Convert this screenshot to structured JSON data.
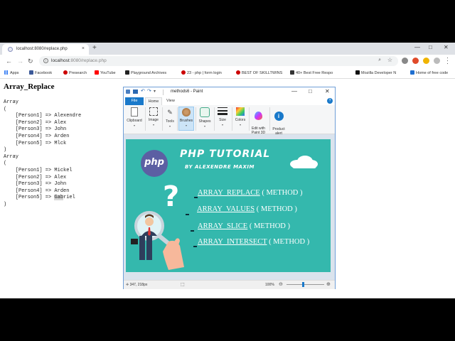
{
  "browser": {
    "tab_title": "localhost:8080/replace.php",
    "tab_close": "×",
    "new_tab": "+",
    "url_host": "localhost",
    "url_rest": ":8080/replace.php",
    "win_minimize": "—",
    "win_maximize": "□",
    "win_close": "✕",
    "bookmarks": [
      {
        "label": "Apps",
        "color": "#4285f4"
      },
      {
        "label": "Facebook",
        "color": "#3b5998"
      },
      {
        "label": "Presearch",
        "color": "#c00"
      },
      {
        "label": "YouTube",
        "color": "#ff0000"
      },
      {
        "label": "Playground Archives",
        "color": "#222"
      },
      {
        "label": "23 - php | form login",
        "color": "#c00"
      },
      {
        "label": "BEST OF SKILLTWINS",
        "color": "#c00"
      },
      {
        "label": "40+ Best Free Respo",
        "color": "#333"
      },
      {
        "label": "Mozilla Developer N",
        "color": "#111"
      },
      {
        "label": "Home of free code",
        "color": "#1f6fd0"
      }
    ]
  },
  "page": {
    "heading": "Array_Replace",
    "array1": {
      "label": "Array",
      "open": "(",
      "close": ")",
      "lines": [
        "    [Person1] => Alexendre",
        "    [Person2] => Alex",
        "    [Person3] => John",
        "    [Person4] => Arden",
        "    [Person5] => Mlck"
      ]
    },
    "array2": {
      "label": "Array",
      "open": "(",
      "close": ")",
      "lines": [
        "    [Person1] => Mickel",
        "    [Person2] => Alex",
        "    [Person3] => John",
        "    [Person4] => Arden"
      ],
      "last_prefix": "    [Person5] => ",
      "last_highlight": "Gab",
      "last_suffix": "riel"
    }
  },
  "paint": {
    "title": "methods6 - Paint",
    "tabs": {
      "file": "File",
      "home": "Home",
      "view": "View",
      "help": "?"
    },
    "groups": [
      {
        "label": "Clipboard"
      },
      {
        "label": "Image"
      },
      {
        "label": "Tools"
      },
      {
        "label": "Brushes"
      },
      {
        "label": "Shapes"
      },
      {
        "label": "Size"
      },
      {
        "label": "Colors"
      },
      {
        "label": "Edit with\nPaint 3D"
      },
      {
        "label": "Product\nalert"
      }
    ],
    "status_pos": "347, 218px",
    "zoom": "100%",
    "zoom_fraction": 0.45,
    "slide": {
      "logo": "php",
      "title": "PHP TUTORIAL",
      "subtitle": "BY ALEXENDRE MAXIM",
      "question": "?",
      "functions": [
        {
          "name": "ARRAY_REPLACE",
          "rest": " ( METHOD )"
        },
        {
          "name": "ARRAY_VALUES",
          "rest": " ( METHOD )"
        },
        {
          "name": "ARRAY_SLICE",
          "rest": " ( METHOD )"
        },
        {
          "name": "ARRAY_INTERSECT",
          "rest": " ( METHOD )"
        }
      ]
    }
  }
}
